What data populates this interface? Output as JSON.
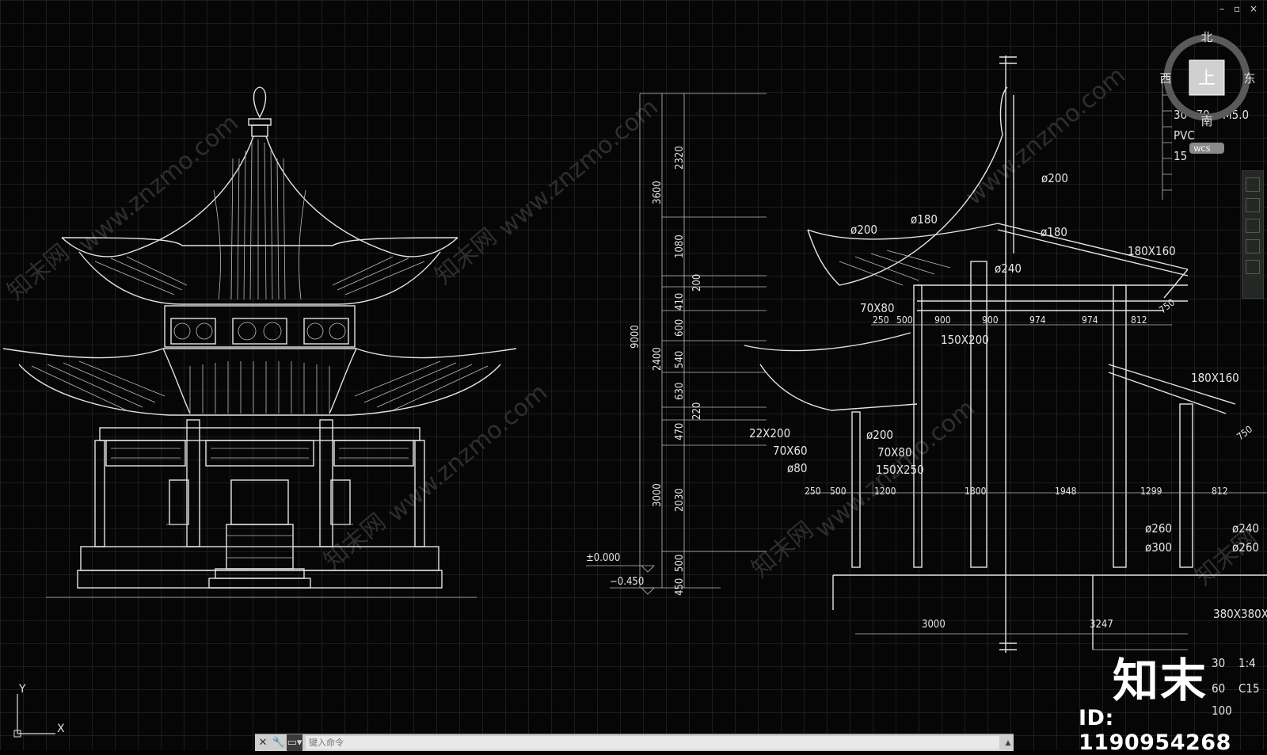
{
  "window": {
    "controls": [
      "–",
      "▫",
      "×"
    ]
  },
  "viewcube": {
    "north": "北",
    "south": "南",
    "east": "东",
    "west": "西",
    "face": "上",
    "ucs": "WCS"
  },
  "command_line": {
    "placeholder": "键入命令"
  },
  "ucs_icon": {
    "x": "X",
    "y": "Y"
  },
  "watermark": {
    "id": "ID: 1190954268",
    "logo": "知末",
    "site": "www.znzmo.com",
    "site_cn": "知末网"
  },
  "elevation": {
    "levels": {
      "zero": "±0.000",
      "ground": "−0.450"
    },
    "dims_total": [
      "3600",
      "9000",
      "3000",
      "450"
    ],
    "dims_detail": [
      "2320",
      "1080",
      "200",
      "410",
      "600",
      "540",
      "630",
      "220",
      "470",
      "2030",
      "500",
      "2400"
    ]
  },
  "section": {
    "labels": {
      "d200_top": "ø200",
      "d200_left": "ø200",
      "d180_left": "ø180",
      "d180_right": "ø180",
      "d240": "ø240",
      "beam_180x160_a": "180X160",
      "beam_180x160_b": "180X160",
      "r70x80_a": "70X80",
      "r150x200": "150X200",
      "r22x200": "22X200",
      "r70x60": "70X60",
      "d80": "ø80",
      "d200_low": "ø200",
      "r70x80_b": "70X80",
      "r150x250": "150X250",
      "d260_a": "ø260",
      "d300": "ø300",
      "d240_b": "ø240",
      "d260_b": "ø260",
      "r380": "380X380X",
      "angle_a": "750",
      "angle_b": "750"
    },
    "dims_upper": [
      "250",
      "500",
      "900",
      "900",
      "974",
      "974",
      "812"
    ],
    "dims_lower": [
      "250",
      "500",
      "1200",
      "1800",
      "1948",
      "1299",
      "812"
    ],
    "dims_base": [
      "3000",
      "3247"
    ],
    "notes": [
      "30~70",
      "M5.0",
      "PVC",
      "15",
      "30",
      "1:4",
      "60",
      "C15",
      "100"
    ]
  }
}
